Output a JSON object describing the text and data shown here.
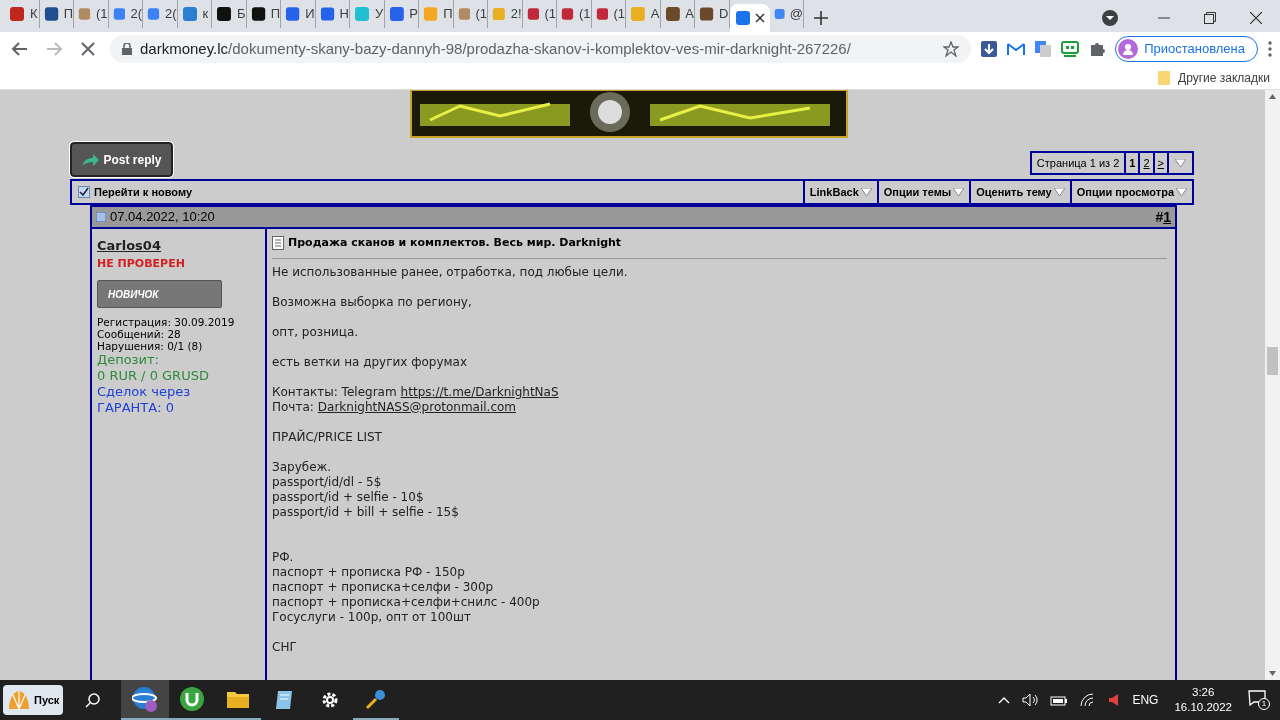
{
  "browser": {
    "tabs": [
      {
        "label": "К",
        "selected": false
      },
      {
        "label": "П",
        "selected": false
      },
      {
        "label": "(1",
        "selected": false
      },
      {
        "label": "2(",
        "selected": false
      },
      {
        "label": "2(",
        "selected": false
      },
      {
        "label": "к",
        "selected": false
      },
      {
        "label": "Б",
        "selected": false
      },
      {
        "label": "П",
        "selected": false
      },
      {
        "label": "И",
        "selected": false
      },
      {
        "label": "Н",
        "selected": false
      },
      {
        "label": "У",
        "selected": false
      },
      {
        "label": "Р",
        "selected": false
      },
      {
        "label": "П",
        "selected": false
      },
      {
        "label": "(1",
        "selected": false
      },
      {
        "label": "2!",
        "selected": false
      },
      {
        "label": "(1",
        "selected": false
      },
      {
        "label": "(1",
        "selected": false
      },
      {
        "label": "(1",
        "selected": false
      },
      {
        "label": "А",
        "selected": false
      },
      {
        "label": "А",
        "selected": false
      },
      {
        "label": "D",
        "selected": false
      },
      {
        "selected": true
      },
      {
        "label": "@",
        "selected": false
      }
    ],
    "url_host": "darkmoney.lc",
    "url_path": "/dokumenty-skany-bazy-dannyh-98/prodazha-skanov-i-komplektov-ves-mir-darknight-267226/",
    "profile_label": "Приостановлена",
    "bookmarks_other": "Другие закладки"
  },
  "forum": {
    "post_reply": "Post reply",
    "pagination": {
      "label": "Страница 1 из 2",
      "pages": [
        {
          "label": "1",
          "selected": true
        },
        {
          "label": "2",
          "selected": false
        },
        {
          "label": ">",
          "selected": false
        }
      ]
    },
    "go_new": "Перейти к новому",
    "menus": [
      "LinkBack",
      "Опции темы",
      "Оценить тему",
      "Опции просмотра"
    ],
    "post": {
      "date": "07.04.2022, 10:20",
      "number_prefix": "#",
      "number": "1",
      "user": {
        "name": "Carlos04",
        "status": "НЕ ПРОВЕРЕН",
        "rank": "НОВИЧОК",
        "stats": [
          "Регистрация: 30.09.2019",
          "Сообщений: 28",
          "Нарушения: 0/1 (8)"
        ],
        "deposit_label": "Депозит:",
        "deposit_value": "0 RUR / 0 GRUSD",
        "deals_label": "Сделок через",
        "deals_value": "ГАРАНТА: 0"
      },
      "title": "Продажа сканов и комплектов. Весь мир. Darknight",
      "lines": [
        {
          "kind": "text",
          "text": "Не использованные ранее, отработка, под любые цели."
        },
        {
          "kind": "gap"
        },
        {
          "kind": "text",
          "text": "Возможна выборка по региону,"
        },
        {
          "kind": "gap"
        },
        {
          "kind": "text",
          "text": "опт, розница."
        },
        {
          "kind": "gap"
        },
        {
          "kind": "text",
          "text": "есть ветки на других форумах"
        },
        {
          "kind": "gap"
        },
        {
          "kind": "link",
          "prefix": "Контакты: Telegram",
          "link": "https://t.me/DarknightNaS"
        },
        {
          "kind": "link",
          "prefix": "Почта:",
          "link": "DarknightNASS@protonmail.com"
        },
        {
          "kind": "gap"
        },
        {
          "kind": "text",
          "text": "ПРАЙС/PRICE LIST"
        },
        {
          "kind": "gap"
        },
        {
          "kind": "text",
          "text": "Зарубеж."
        },
        {
          "kind": "text",
          "text": "passport/id/dl - 5$"
        },
        {
          "kind": "text",
          "text": "passport/id + selfie - 10$"
        },
        {
          "kind": "text",
          "text": "passport/id + bill + selfie - 15$"
        },
        {
          "kind": "gap"
        },
        {
          "kind": "gap"
        },
        {
          "kind": "text",
          "text": "РФ."
        },
        {
          "kind": "text",
          "text": "паспорт + прописка РФ - 150р"
        },
        {
          "kind": "text",
          "text": "паспорт + прописка+селфи - 300р"
        },
        {
          "kind": "text",
          "text": "паспорт + прописка+селфи+снилс - 400р"
        },
        {
          "kind": "text",
          "text": "Госуслуги - 100р, опт от 100шт"
        },
        {
          "kind": "gap"
        },
        {
          "kind": "text",
          "text": "СНГ"
        }
      ]
    }
  },
  "taskbar": {
    "start": "Пуск",
    "lang": "ENG",
    "time": "3:26",
    "date": "16.10.2022",
    "notifications": "1"
  }
}
